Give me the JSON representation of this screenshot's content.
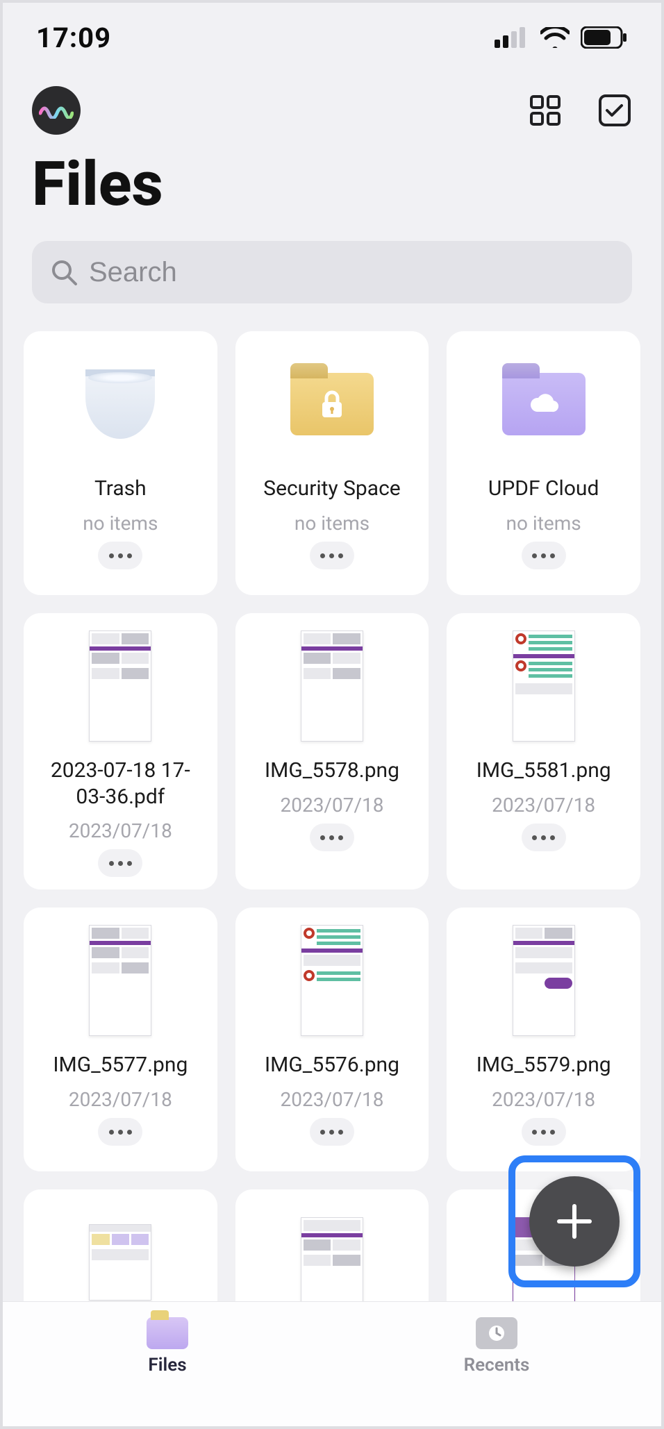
{
  "status": {
    "time": "17:09"
  },
  "page_title": "Files",
  "search": {
    "placeholder": "Search"
  },
  "folders": [
    {
      "name": "Trash",
      "subtitle": "no items",
      "icon": "trash"
    },
    {
      "name": "Security Space",
      "subtitle": "no items",
      "icon": "lock-folder"
    },
    {
      "name": "UPDF Cloud",
      "subtitle": "no items",
      "icon": "cloud-folder"
    }
  ],
  "files": [
    {
      "name": "2023-07-18 17-03-36.pdf",
      "date": "2023/07/18",
      "thumb": "doc-a"
    },
    {
      "name": "IMG_5578.png",
      "date": "2023/07/18",
      "thumb": "doc-a"
    },
    {
      "name": "IMG_5581.png",
      "date": "2023/07/18",
      "thumb": "doc-b"
    },
    {
      "name": "IMG_5577.png",
      "date": "2023/07/18",
      "thumb": "doc-a"
    },
    {
      "name": "IMG_5576.png",
      "date": "2023/07/18",
      "thumb": "doc-b"
    },
    {
      "name": "IMG_5579.png",
      "date": "2023/07/18",
      "thumb": "doc-c"
    },
    {
      "name": "",
      "date": "",
      "thumb": "doc-d"
    },
    {
      "name": "",
      "date": "",
      "thumb": "doc-a"
    },
    {
      "name": "",
      "date": "",
      "thumb": "doc-e"
    }
  ],
  "tabs": [
    {
      "label": "Files",
      "active": true
    },
    {
      "label": "Recents",
      "active": false
    }
  ]
}
